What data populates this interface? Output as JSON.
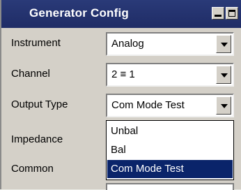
{
  "window": {
    "title": "Generator Config"
  },
  "fields": [
    {
      "label": "Instrument",
      "value": "Analog"
    },
    {
      "label": "Channel",
      "value": "2 ≡ 1"
    },
    {
      "label": "Output Type",
      "value": "Com Mode Test"
    },
    {
      "label": "Impedance"
    },
    {
      "label": "Common"
    }
  ],
  "dropdown": {
    "options": [
      "Unbal",
      "Bal",
      "Com Mode Test"
    ],
    "selected": "Com Mode Test"
  },
  "colors": {
    "titlebar": "#1f2c66",
    "selection": "#0a246a",
    "panel": "#d4d0c8"
  }
}
